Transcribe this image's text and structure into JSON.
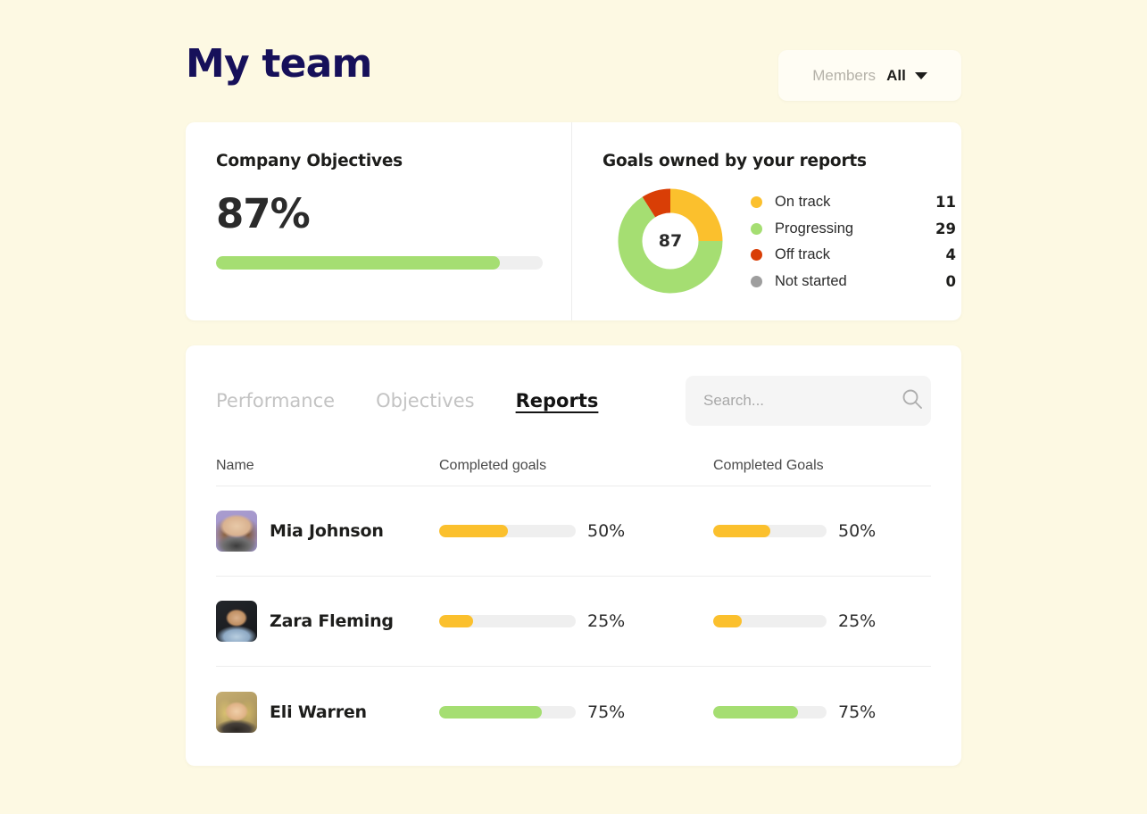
{
  "page": {
    "background_color": "#FDF9E3",
    "title": "My team"
  },
  "header": {
    "title": "My team",
    "members_filter": {
      "label": "Members",
      "value": "All",
      "icon": "chevron-down-icon"
    }
  },
  "objectives_card": {
    "title": "Company Objectives",
    "percent_label": "87%",
    "percent_value": 87,
    "bar_color": "#A5DE72",
    "track_color": "#EFEFEF"
  },
  "goals_card": {
    "title": "Goals owned by your reports",
    "donut_center_label": "87",
    "legend": [
      {
        "label": "On track",
        "count": "11",
        "color": "#FBC02D"
      },
      {
        "label": "Progressing",
        "count": "29",
        "color": "#A5DE72"
      },
      {
        "label": "Off track",
        "count": "4",
        "color": "#D93E06"
      },
      {
        "label": "Not started",
        "count": "0",
        "color": "#9E9E9E"
      }
    ]
  },
  "chart_data": {
    "type": "pie",
    "title": "Goals owned by your reports",
    "center_label": "87",
    "categories": [
      "On track",
      "Progressing",
      "Off track",
      "Not started"
    ],
    "values": [
      11,
      29,
      4,
      0
    ],
    "colors": [
      "#FBC02D",
      "#A5DE72",
      "#D93E06",
      "#9E9E9E"
    ],
    "percentages": [
      25,
      66,
      9,
      0
    ],
    "legend_position": "right",
    "donut": true,
    "start_angle_deg": 0
  },
  "panel": {
    "tabs": [
      {
        "label": "Performance",
        "active": false
      },
      {
        "label": "Objectives",
        "active": false
      },
      {
        "label": "Reports",
        "active": true
      }
    ],
    "search": {
      "placeholder": "Search...",
      "value": "",
      "icon": "search-icon"
    },
    "table": {
      "columns": [
        "Name",
        "Completed goals",
        "Completed Goals"
      ],
      "rows": [
        {
          "name": "Mia Johnson",
          "avatar": "avatar-mia-johnson",
          "goals1_label": "50%",
          "goals1_value": 50,
          "goals1_color": "#FBC02D",
          "goals2_label": "50%",
          "goals2_value": 50,
          "goals2_color": "#FBC02D"
        },
        {
          "name": "Zara Fleming",
          "avatar": "avatar-zara-fleming",
          "goals1_label": "25%",
          "goals1_value": 25,
          "goals1_color": "#FBC02D",
          "goals2_label": "25%",
          "goals2_value": 25,
          "goals2_color": "#FBC02D"
        },
        {
          "name": "Eli Warren",
          "avatar": "avatar-eli-warren",
          "goals1_label": "75%",
          "goals1_value": 75,
          "goals1_color": "#A5DE72",
          "goals2_label": "75%",
          "goals2_value": 75,
          "goals2_color": "#A5DE72"
        }
      ]
    }
  }
}
